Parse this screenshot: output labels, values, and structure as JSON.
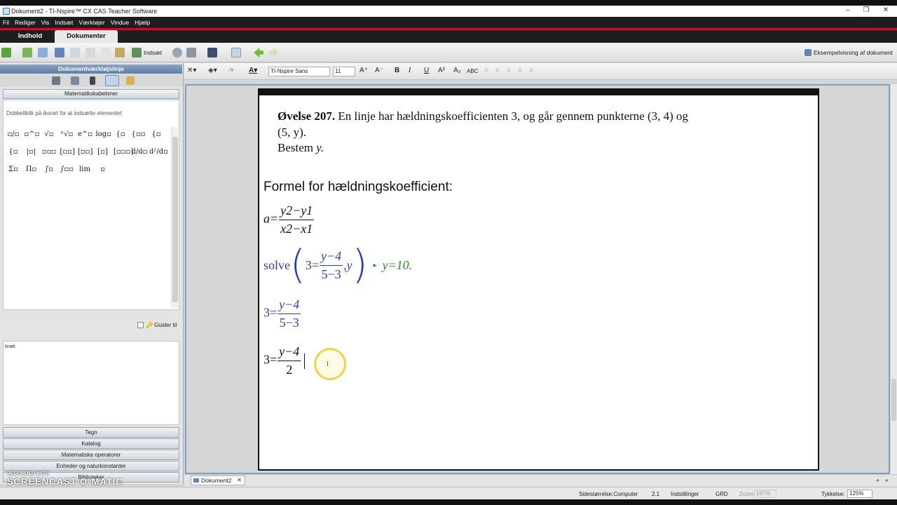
{
  "window": {
    "title": "Dokument2 - TI-Nspire™ CX CAS Teacher Software",
    "controls": [
      "–",
      "❐",
      "✕"
    ]
  },
  "menu": [
    "Fil",
    "Rediger",
    "Vis",
    "Indsæt",
    "Værktøjer",
    "Vindue",
    "Hjælp"
  ],
  "tabs": {
    "indhold": "Indhold",
    "dokumenter": "Dokumenter"
  },
  "toolbar": {
    "insert_label": "Indsæt",
    "preview_label": "Eksempelvisning af dokument"
  },
  "left_panel": {
    "title": "Dokumentværktøjslinje",
    "math_templates": "Matematikskabeloner",
    "hint": "Dobbeltklik på ikonet for at indsætte elementet",
    "templates": [
      "▫/▫",
      "▫^▫",
      "√▫",
      "ⁿ√▫",
      "e^▫",
      "log▫",
      "{▫",
      "{▫▫",
      "{▫",
      "{▫",
      "|▫|",
      "▫▫▫",
      "[▫▫]",
      "[▫▫]",
      "[▫]",
      "[▫▫▫]",
      "d/d▫",
      "d²/d▫",
      "Σ▫",
      "Π▫",
      "∫▫",
      "∫▫▫",
      "lim",
      "▫"
    ],
    "guider_label": "Guider til",
    "help_text": "brøk",
    "accordions": [
      "Tegn",
      "Katalog",
      "Matematiske operatorer",
      "Enheder og naturkonstanter",
      "Biblioteker"
    ]
  },
  "format_bar": {
    "font": "TI-Nspire Sans",
    "size": "11",
    "bold": "B",
    "italic": "I",
    "underline": "U",
    "caps": "ABC"
  },
  "document": {
    "problem_title": "Øvelse 207.",
    "problem_text_1": " En linje har hældningskoefficienten 3, og går gennem punkterne (3, 4) og",
    "problem_text_2": "(5, y).",
    "problem_text_3": "Bestem ",
    "problem_var": "y.",
    "heading": "Formel for hældningskoefficient:",
    "formula": {
      "lhs": "a=",
      "num": "y2−y1",
      "den": "x2−x1"
    },
    "solve": {
      "fn": "solve",
      "lhs": "3=",
      "num": "y−4",
      "den": "5−3",
      "var": ",y",
      "arrow": "▸",
      "result": "y=10."
    },
    "eq1": {
      "lhs": "3=",
      "num": "y−4",
      "den": "5−3"
    },
    "eq2": {
      "lhs": "3=",
      "num": "y−4",
      "den": "2"
    }
  },
  "doc_tab": {
    "label": "Dokument2",
    "close": "✕"
  },
  "status": {
    "page_size": "Sidestørrelse:Computer",
    "page": "2.1",
    "settings": "Indstillinger",
    "angle": "GRD",
    "zoom_label": "Zoom:",
    "zoom_value": "197%",
    "thickness_label": "Tykkelse:",
    "thickness_value": "125%"
  },
  "watermark": {
    "line1": "RECORDED WITH",
    "line2": "SCREENCAST-O-MATIC"
  }
}
